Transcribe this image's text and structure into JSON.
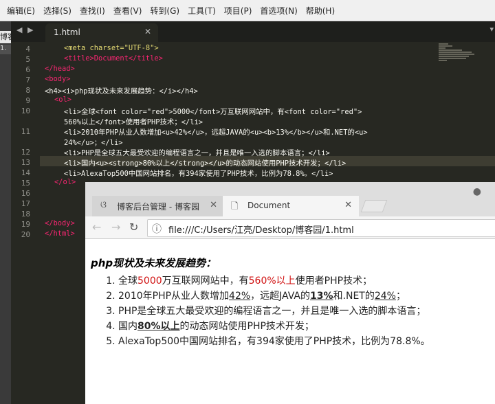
{
  "menu": [
    "编辑(E)",
    "选择(S)",
    "查找(I)",
    "查看(V)",
    "转到(G)",
    "工具(T)",
    "项目(P)",
    "首选项(N)",
    "帮助(H)"
  ],
  "sidebar": {
    "tab_title": "博客园",
    "tab_num": "1."
  },
  "editor": {
    "file_tab": "1.html",
    "line_numbers": [
      "4",
      "5",
      "6",
      "7",
      "8",
      "9",
      "10",
      "",
      "11",
      "",
      "12",
      "13",
      "14",
      "15",
      "16",
      "17",
      "18",
      "19",
      "20"
    ],
    "code": {
      "l4": "<meta charset=\"UTF-8\">",
      "l5": "<title>Document</title>",
      "l6": "</head>",
      "l7": "<body>",
      "l8": "<h4><i>php现状及未来发展趋势：</i></h4>",
      "l9": "<ol>",
      "l10a": "<li>全球<font color=\"red\">5000</font>万互联网网站中，有<font color=\"red\">",
      "l10b": "560%以上</font>使用者PHP技术；</li>",
      "l11a": "<li>2010年PHP从业人数增加<u>42%</u>，远超JAVA的<u><b>13%</b></u>和.NET的<u>",
      "l11b": "24%</u>；</li>",
      "l12": "<li>PHP是全球五大最受欢迎的编程语言之一，并且是唯一入选的脚本语言；</li>",
      "l13": "<li>国内<u><strong>80%以上</strong></u>的动态网站使用PHP技术开发；</li>",
      "l14": "<li>AlexaTop500中国网站排名，有394家使用了PHP技术，比例为78.8%。</li>",
      "l15": "</ol>",
      "l19": "</body>",
      "l20": "</html>"
    }
  },
  "browser": {
    "tab1": "博客后台管理 - 博客园",
    "tab2": "Document",
    "url": "file:///C:/Users/江亮/Desktop/博客园/1.html",
    "page_title": "php现状及未来发展趋势：",
    "items": {
      "i1": {
        "a": "全球",
        "b": "5000",
        "c": "万互联网网站中，有",
        "d": "560%以上",
        "e": "使用者PHP技术；"
      },
      "i2": {
        "a": "2010年PHP从业人数增加",
        "b": "42%",
        "c": "，远超JAVA的",
        "d": "13%",
        "e": "和.NET的",
        "f": "24%",
        "g": "；"
      },
      "i3": "PHP是全球五大最受欢迎的编程语言之一，并且是唯一入选的脚本语言；",
      "i4": {
        "a": "国内",
        "b": "80%以上",
        "c": "的动态网站使用PHP技术开发；"
      },
      "i5": "AlexaTop500中国网站排名，有394家使用了PHP技术，比例为78.8%。"
    }
  },
  "colors": {
    "editor_bg": "#272822",
    "tag": "#f92672",
    "attr": "#a6e22e",
    "string": "#e6db74",
    "red_text": "#d01010"
  },
  "icons": [
    "chevron-left-icon",
    "chevron-right-icon",
    "close-icon",
    "file-icon",
    "user-icon",
    "back-icon",
    "forward-icon",
    "reload-icon",
    "info-icon"
  ]
}
